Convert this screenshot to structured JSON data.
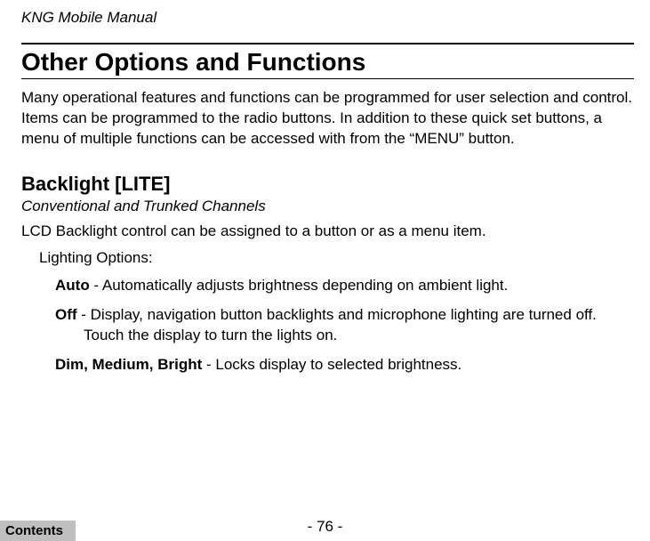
{
  "header": {
    "doc_title": "KNG Mobile Manual"
  },
  "section": {
    "title": "Other Options and Functions",
    "intro": "Many operational features and functions can be programmed for user selection and control. Items can be programmed to the radio buttons. In addition to these quick set buttons, a menu of multiple functions can be accessed with from the “MENU” button."
  },
  "subsection": {
    "title": "Backlight [LITE]",
    "subtitle": "Conventional and Trunked Channels",
    "desc": "LCD Backlight control can be assigned to a button or as a menu item.",
    "options_label": "Lighting Options:",
    "options": [
      {
        "name": "Auto",
        "text": " - Automatically adjusts brightness depending on ambient light."
      },
      {
        "name": "Off",
        "text": " - Display, navigation button backlights and microphone lighting are turned off.",
        "cont": "Touch the display to turn the lights on."
      },
      {
        "name": "Dim, Medium, Bright",
        "text": " - Locks display to selected brightness."
      }
    ]
  },
  "footer": {
    "page": "- 76 -",
    "contents": "Contents"
  }
}
